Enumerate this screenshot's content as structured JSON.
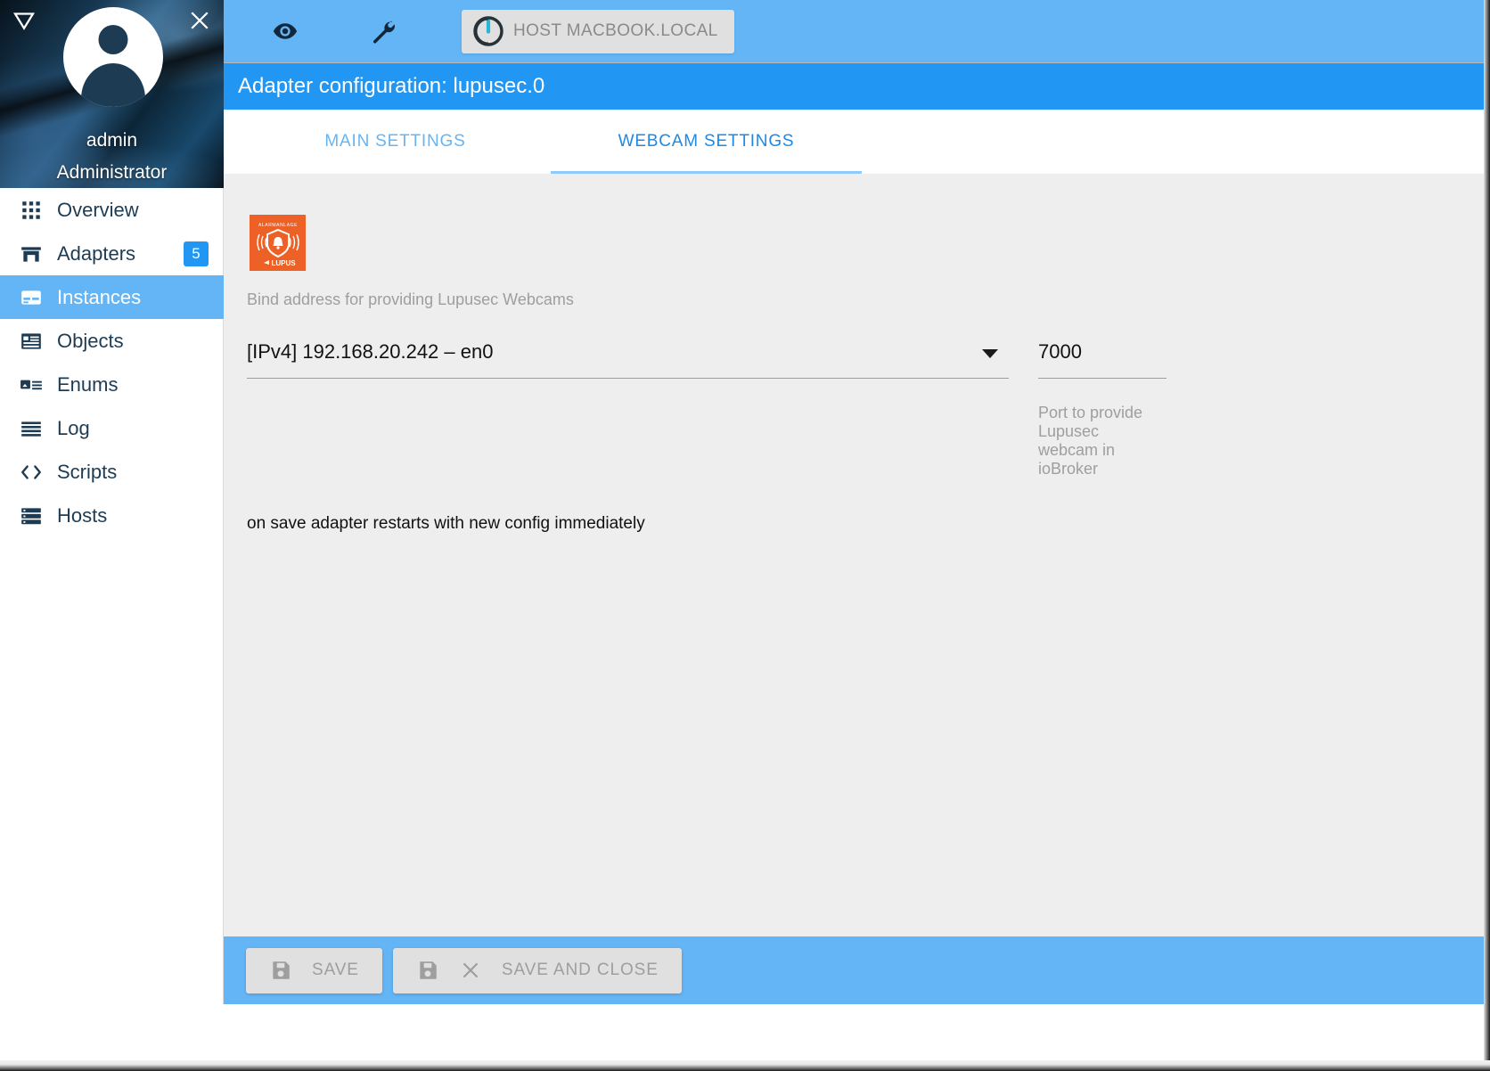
{
  "sidebar": {
    "collapse_icon": "triangle-down-icon",
    "close_icon": "close-icon",
    "user": {
      "name": "admin",
      "role": "Administrator"
    },
    "items": [
      {
        "label": "Overview",
        "icon": "grid-icon",
        "badge": null,
        "active": false
      },
      {
        "label": "Adapters",
        "icon": "store-icon",
        "badge": "5",
        "active": false
      },
      {
        "label": "Instances",
        "icon": "card-icon",
        "badge": null,
        "active": true
      },
      {
        "label": "Objects",
        "icon": "list-alt-icon",
        "badge": null,
        "active": false
      },
      {
        "label": "Enums",
        "icon": "enum-icon",
        "badge": null,
        "active": false
      },
      {
        "label": "Log",
        "icon": "lines-icon",
        "badge": null,
        "active": false
      },
      {
        "label": "Scripts",
        "icon": "code-icon",
        "badge": null,
        "active": false
      },
      {
        "label": "Hosts",
        "icon": "server-icon",
        "badge": null,
        "active": false
      }
    ]
  },
  "toolbar": {
    "eye_icon": "eye-icon",
    "wrench_icon": "wrench-icon",
    "host_icon": "power-info-icon",
    "host_label": "HOST MACBOOK.LOCAL"
  },
  "header": {
    "title": "Adapter configuration: lupusec.0"
  },
  "tabs": [
    {
      "label": "MAIN SETTINGS",
      "active": false
    },
    {
      "label": "WEBCAM SETTINGS",
      "active": true
    }
  ],
  "panel": {
    "logo_icon": "lupus-shield-icon",
    "logo_bg": "#ee6126",
    "bind_hint": "Bind address for providing Lupusec Webcams",
    "bind_value": "[IPv4] 192.168.20.242 – en0",
    "dropdown_icon": "chevron-down-icon",
    "port_value": "7000",
    "port_help": "Port to provide Lupusec webcam in ioBroker",
    "restart_note": "on save adapter restarts with new config immediately"
  },
  "footer": {
    "save_icon": "floppy-icon",
    "save_label": "SAVE",
    "save_close_save_icon": "floppy-icon",
    "save_close_x_icon": "close-icon",
    "save_close_label": "SAVE AND CLOSE"
  },
  "colors": {
    "toolbar_blue": "#64b5f6",
    "header_blue": "#2196f3",
    "accent_orange": "#ee6126",
    "sidebar_text": "#1d3c54"
  }
}
